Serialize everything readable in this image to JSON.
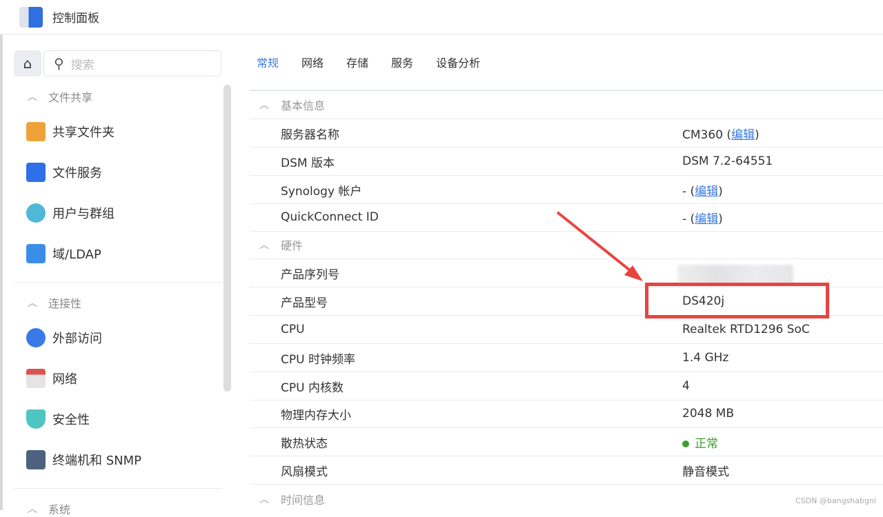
{
  "window": {
    "title": "控制面板"
  },
  "sidebar": {
    "search_placeholder": "搜索",
    "groups": [
      {
        "label": "文件共享",
        "items": [
          {
            "label": "共享文件夹"
          },
          {
            "label": "文件服务"
          },
          {
            "label": "用户与群组"
          },
          {
            "label": "域/LDAP"
          }
        ]
      },
      {
        "label": "连接性",
        "items": [
          {
            "label": "外部访问"
          },
          {
            "label": "网络"
          },
          {
            "label": "安全性"
          },
          {
            "label": "终端机和 SNMP"
          }
        ]
      },
      {
        "label": "系统"
      }
    ]
  },
  "tabs": [
    {
      "label": "常规"
    },
    {
      "label": "网络"
    },
    {
      "label": "存储"
    },
    {
      "label": "服务"
    },
    {
      "label": "设备分析"
    }
  ],
  "sections": {
    "basic": "基本信息",
    "hardware": "硬件",
    "time": "时间信息"
  },
  "rows": [
    {
      "label": "服务器名称",
      "value": "CM360 (",
      "link": "编辑",
      "suffix": ")"
    },
    {
      "label": "DSM 版本",
      "value": "DSM 7.2-64551"
    },
    {
      "label": "Synology 帐户",
      "value": "- (",
      "link": "编辑",
      "suffix": ")"
    },
    {
      "label": "QuickConnect ID",
      "value": "- (",
      "link": "编辑",
      "suffix": ")"
    },
    {
      "label": "产品序列号",
      "value": ""
    },
    {
      "label": "产品型号",
      "value": "DS420j"
    },
    {
      "label": "CPU",
      "value": "Realtek RTD1296 SoC"
    },
    {
      "label": "CPU 时钟频率",
      "value": "1.4 GHz"
    },
    {
      "label": "CPU 内核数",
      "value": "4"
    },
    {
      "label": "物理内存大小",
      "value": "2048 MB"
    },
    {
      "label": "散热状态",
      "value": "正常"
    },
    {
      "label": "风扇模式",
      "value": "静音模式"
    }
  ],
  "watermark": "CSDN @bangshabgni",
  "colors": {
    "accent": "#3a7ae0",
    "annotation": "#e8443f",
    "ok": "#3b9e2e"
  }
}
